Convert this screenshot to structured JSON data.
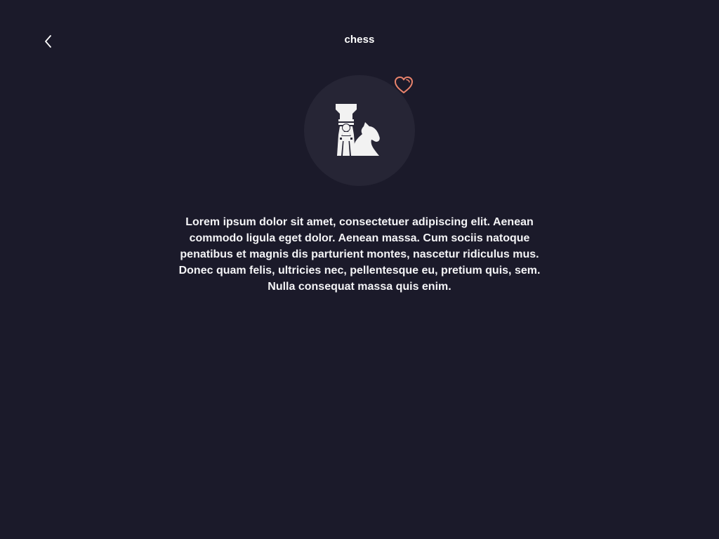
{
  "header": {
    "title": "chess",
    "back_icon": "chevron-left-icon"
  },
  "game": {
    "icon": "chess-pieces-icon",
    "favorite_icon": "heart-outline-icon",
    "description": "Lorem ipsum dolor sit amet, consectetuer adipiscing elit. Aenean commodo ligula eget dolor. Aenean massa. Cum sociis natoque penatibus et magnis dis parturient montes, nascetur ridiculus mus. Donec quam felis, ultricies nec, pellentesque eu, pretium quis, sem. Nulla consequat massa quis enim."
  },
  "colors": {
    "background": "#1b1a2a",
    "icon_circle": "#262535",
    "accent_heart": "#e9836c",
    "text": "#ffffff"
  }
}
